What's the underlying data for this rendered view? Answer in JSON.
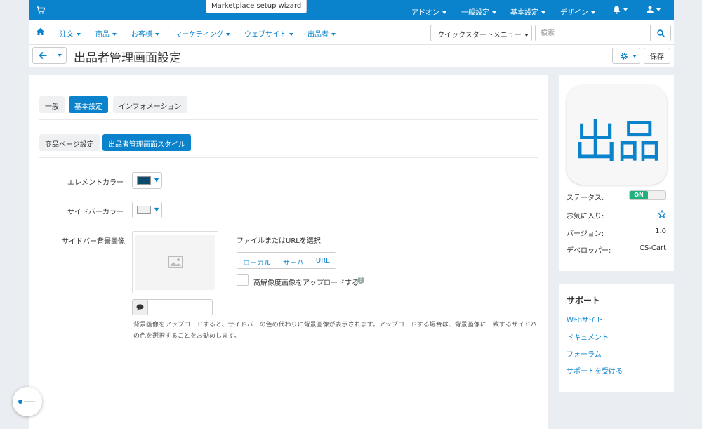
{
  "topbar": {
    "wizard": "Marketplace setup wizard",
    "menus": [
      {
        "label": "アドオン"
      },
      {
        "label": "一般設定"
      },
      {
        "label": "基本設定"
      },
      {
        "label": "デザイン"
      }
    ],
    "icons": [
      "cart-icon",
      "bell-icon",
      "user-icon"
    ],
    "accent": "#0b83cc"
  },
  "navbar": {
    "items": [
      {
        "label": "注文"
      },
      {
        "label": "商品"
      },
      {
        "label": "お客様"
      },
      {
        "label": "マーケティング"
      },
      {
        "label": "ウェブサイト"
      },
      {
        "label": "出品者"
      }
    ],
    "quickstart": "クイックスタートメニュー",
    "search_placeholder": "検索"
  },
  "titlebar": {
    "title": "出品者管理画面設定",
    "save": "保存"
  },
  "tabs": [
    {
      "label": "一般",
      "active": false
    },
    {
      "label": "基本設定",
      "active": true
    },
    {
      "label": "インフォメーション",
      "active": false
    }
  ],
  "subtabs": [
    {
      "label": "商品ページ設定",
      "active": false
    },
    {
      "label": "出品者管理画面スタイル",
      "active": true
    }
  ],
  "form": {
    "element_color": {
      "label": "エレメントカラー",
      "value": "#0d4a6e"
    },
    "sidebar_color": {
      "label": "サイドバーカラー",
      "value": "#eef0f2"
    },
    "sidebar_image": {
      "label": "サイドバー背景画像",
      "select_label": "ファイルまたはURLを選択",
      "sources": [
        "ローカル",
        "サーバ",
        "URL"
      ],
      "hires_label": "高解像度画像をアップロードする",
      "alt_value": ""
    },
    "help": "背景画像をアップロードすると、サイドバーの色の代わりに背景画像が表示されます。アップロードする場合は、背景画像に一致するサイドバーの色を選択することをお勧めします。"
  },
  "addon": {
    "logo_text": "出品",
    "status_label": "ステータス:",
    "status_value": "ON",
    "favorite_label": "お気に入り:",
    "version_label": "バージョン:",
    "version_value": "1.0",
    "developer_label": "デベロッパー:",
    "developer_value": "CS-Cart"
  },
  "support": {
    "title": "サポート",
    "links": [
      {
        "label": "Webサイト"
      },
      {
        "label": "ドキュメント"
      },
      {
        "label": "フォーラム"
      },
      {
        "label": "サポートを受ける"
      }
    ]
  }
}
